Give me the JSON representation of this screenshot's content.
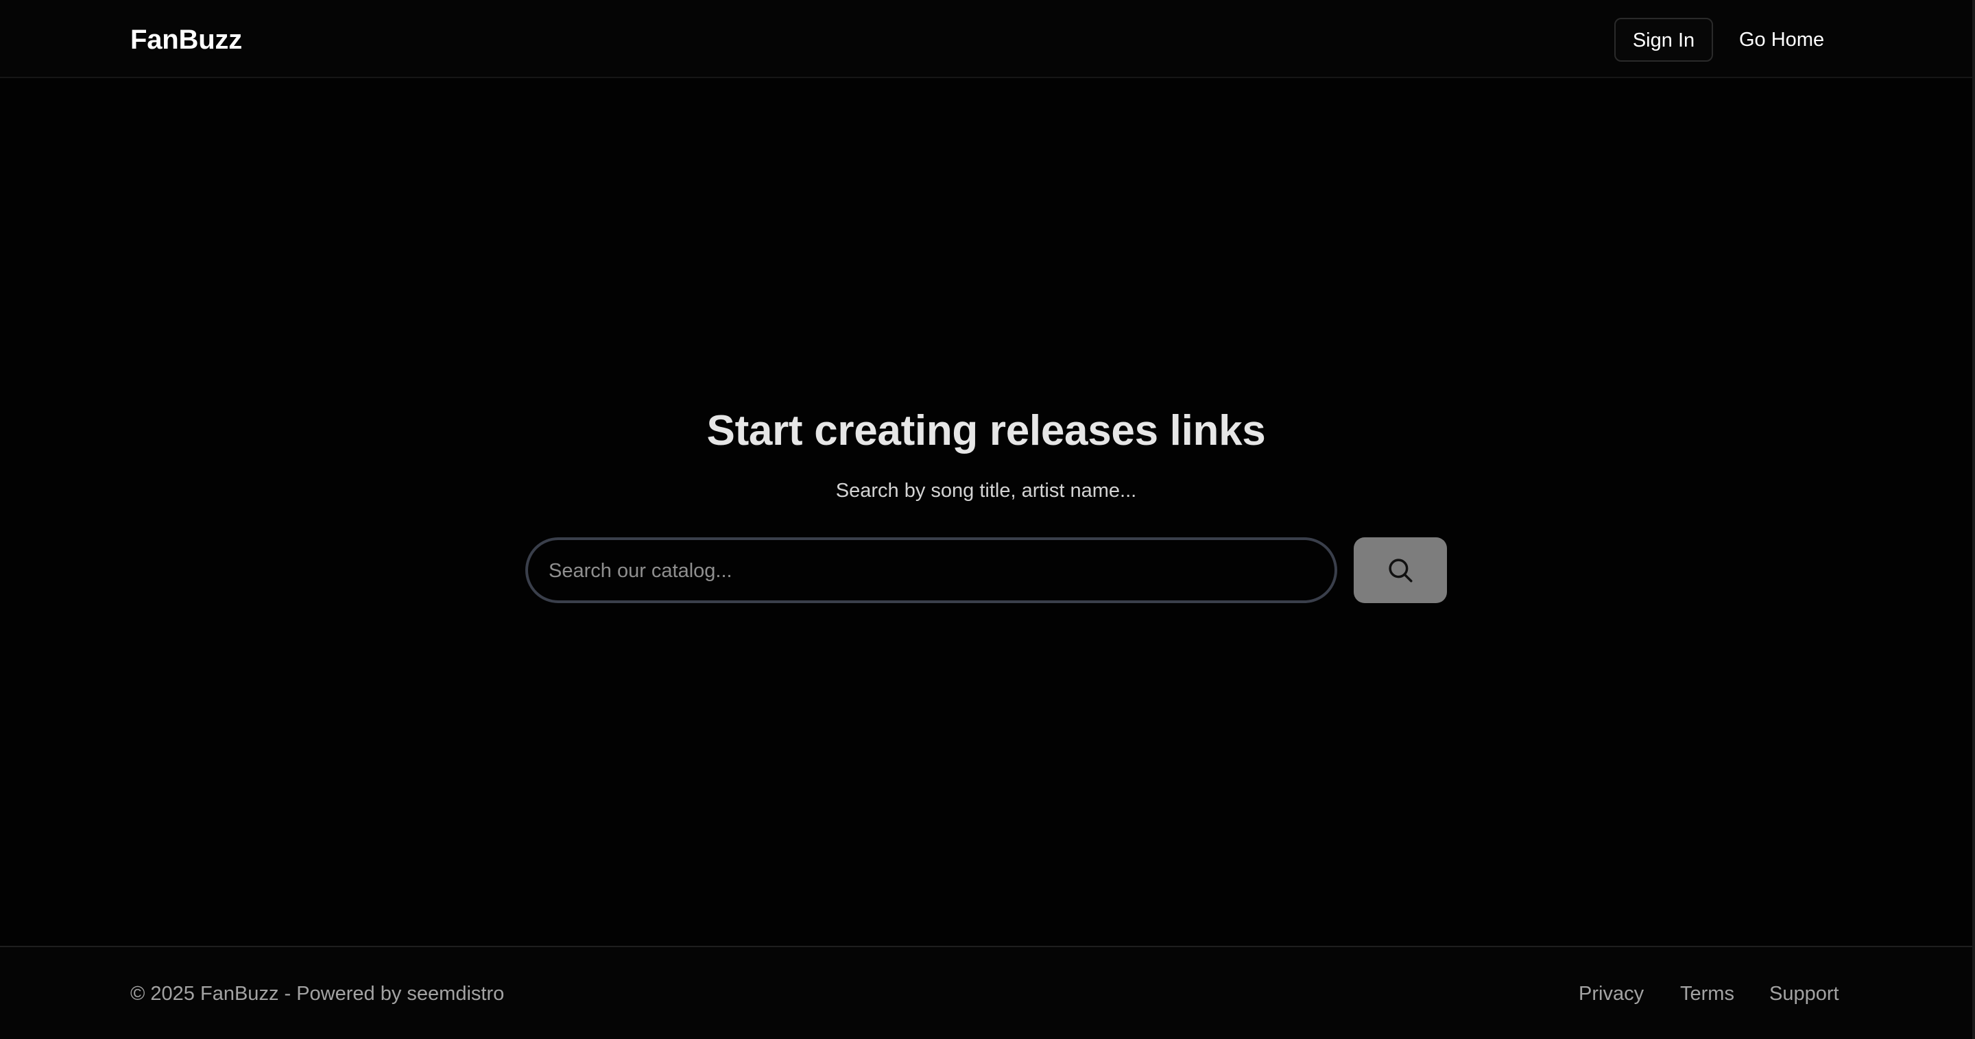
{
  "header": {
    "logo": "FanBuzz",
    "sign_in_label": "Sign In",
    "go_home_label": "Go Home"
  },
  "hero": {
    "title": "Start creating releases links",
    "subtitle": "Search by song title, artist name..."
  },
  "search": {
    "placeholder": "Search our catalog...",
    "value": "",
    "button_icon": "search-icon"
  },
  "footer": {
    "copyright": "© 2025 FanBuzz - Powered by seemdistro",
    "links": [
      {
        "label": "Privacy"
      },
      {
        "label": "Terms"
      },
      {
        "label": "Support"
      }
    ]
  },
  "colors": {
    "background": "#020202",
    "search_button": "#7d7d7d",
    "search_border": "#3a3f4b",
    "muted_text": "#a3a3a3"
  }
}
